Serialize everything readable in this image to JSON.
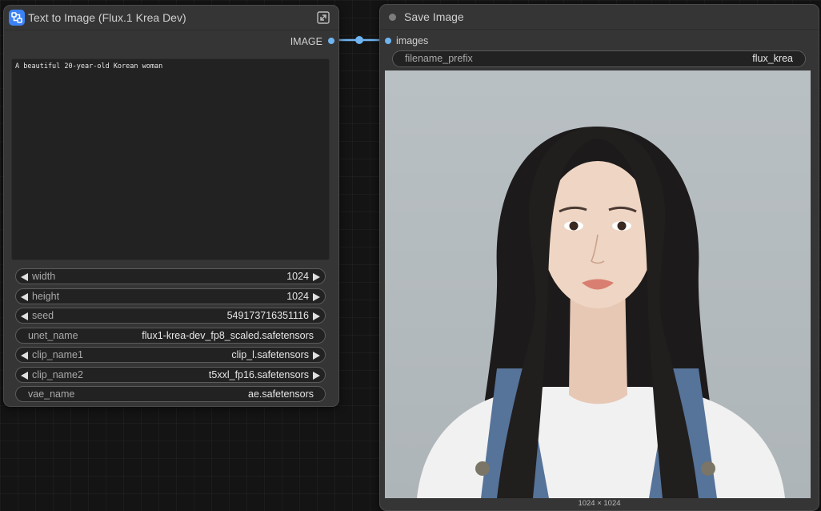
{
  "text_to_image_node": {
    "title": "Text to Image (Flux.1 Krea Dev)",
    "output_label": "IMAGE",
    "prompt": "A beautiful 20-year-old Korean woman",
    "widgets": [
      {
        "label": "width",
        "value": "1024"
      },
      {
        "label": "height",
        "value": "1024"
      },
      {
        "label": "seed",
        "value": "549173716351116"
      },
      {
        "label": "unet_name",
        "value": "flux1-krea-dev_fp8_scaled.safetensors"
      },
      {
        "label": "clip_name1",
        "value": "clip_l.safetensors"
      },
      {
        "label": "clip_name2",
        "value": "t5xxl_fp16.safetensors"
      },
      {
        "label": "vae_name",
        "value": "ae.safetensors"
      }
    ]
  },
  "save_image_node": {
    "title": "Save Image",
    "input_label": "images",
    "filename_prefix_label": "filename_prefix",
    "filename_prefix_value": "flux_krea",
    "image_size": "1024 × 1024"
  },
  "colors": {
    "link": "#6fb4f0",
    "badge": "#3b82f6",
    "node_bg": "#353535"
  },
  "icons": [
    "subgraph-icon",
    "expand-icon",
    "status-dot-icon",
    "arrow-left-icon",
    "arrow-right-icon"
  ]
}
